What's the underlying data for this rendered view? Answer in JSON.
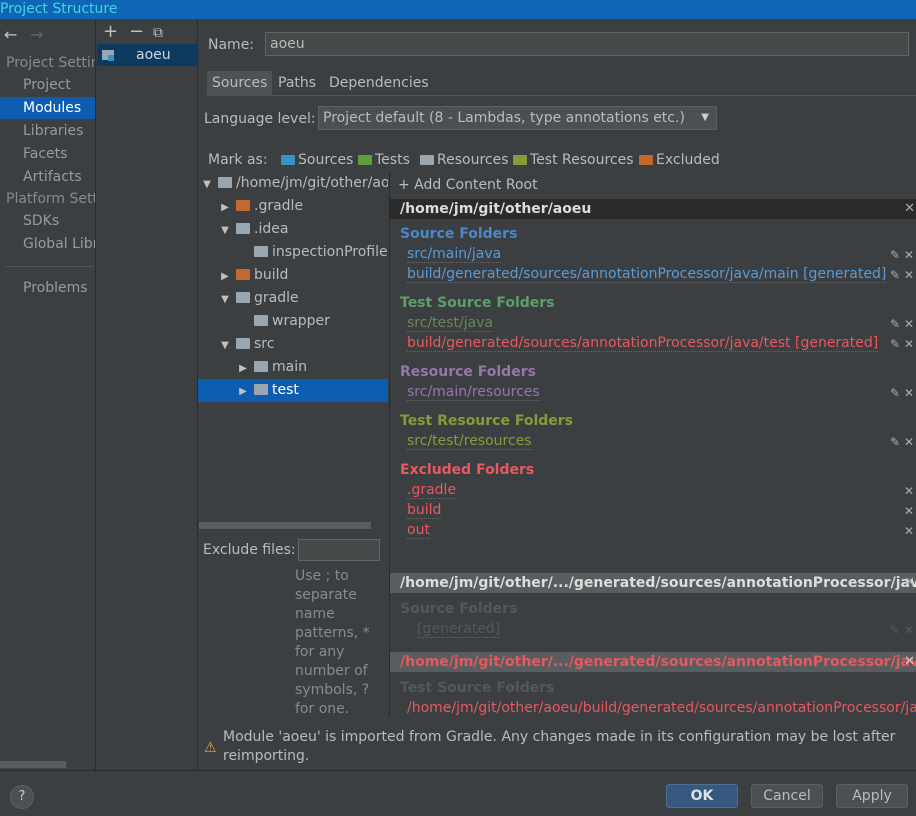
{
  "window": {
    "title": "Project Structure"
  },
  "nav": {
    "back": "←",
    "forward": "→",
    "project_settings": "Project Settings",
    "items_project": [
      "Project",
      "Modules",
      "Libraries",
      "Facets",
      "Artifacts"
    ],
    "platform_settings": "Platform Settings",
    "items_platform": [
      "SDKs",
      "Global Libraries"
    ],
    "problems": "Problems",
    "selected": "Modules"
  },
  "modules": {
    "add": "+",
    "remove": "−",
    "copy": "⧉",
    "items": [
      "aoeu"
    ]
  },
  "name": {
    "label": "Name:",
    "value": "aoeu"
  },
  "tabs": [
    "Sources",
    "Paths",
    "Dependencies"
  ],
  "selected_tab": "Sources",
  "language": {
    "label": "Language level:",
    "value": "Project default (8 - Lambdas, type annotations etc.)"
  },
  "mark_as": {
    "label": "Mark as:",
    "items": [
      "Sources",
      "Tests",
      "Resources",
      "Test Resources",
      "Excluded"
    ]
  },
  "tree": [
    {
      "label": "/home/jm/git/other/aoeu",
      "indent": 0,
      "arrow": "▼",
      "color": "grey"
    },
    {
      "label": ".gradle",
      "indent": 1,
      "arrow": "▶",
      "color": "orange"
    },
    {
      "label": ".idea",
      "indent": 1,
      "arrow": "▼",
      "color": "grey"
    },
    {
      "label": "inspectionProfiles",
      "indent": 2,
      "arrow": "",
      "color": "grey"
    },
    {
      "label": "build",
      "indent": 1,
      "arrow": "▶",
      "color": "orange"
    },
    {
      "label": "gradle",
      "indent": 1,
      "arrow": "▼",
      "color": "grey"
    },
    {
      "label": "wrapper",
      "indent": 2,
      "arrow": "",
      "color": "grey"
    },
    {
      "label": "src",
      "indent": 1,
      "arrow": "▼",
      "color": "grey"
    },
    {
      "label": "main",
      "indent": 2,
      "arrow": "▶",
      "color": "grey"
    },
    {
      "label": "test",
      "indent": 2,
      "arrow": "▶",
      "color": "grey",
      "selected": true
    }
  ],
  "exclude": {
    "label": "Exclude files:",
    "value": "",
    "hint": [
      "Use ; to",
      "separate",
      "name",
      "patterns, *",
      "for any",
      "number of",
      "symbols, ?",
      "for one."
    ]
  },
  "content_root": {
    "add": "+ Add Content Root",
    "root1": "/home/jm/git/other/aoeu",
    "source_folders": "Source Folders",
    "source_paths": [
      "src/main/java",
      "build/generated/sources/annotationProcessor/java/main [generated]"
    ],
    "test_source_folders": "Test Source Folders",
    "test_paths": [
      "src/test/java",
      "build/generated/sources/annotationProcessor/java/test [generated]"
    ],
    "resource_folders": "Resource Folders",
    "resource_paths": [
      "src/main/resources"
    ],
    "test_resource_folders": "Test Resource Folders",
    "test_resource_paths": [
      "src/test/resources"
    ],
    "excluded_folders": "Excluded Folders",
    "excluded_paths": [
      ".gradle",
      "build",
      "out"
    ],
    "root2": "/home/jm/git/other/.../generated/sources/annotationProcessor/java/main",
    "root2_section": "Source Folders",
    "root2_path": "[generated]",
    "root3": "/home/jm/git/other/.../generated/sources/annotationProcessor/java/test",
    "root3_section": "Test Source Folders",
    "root3_path": "/home/jm/git/other/aoeu/build/generated/sources/annotationProcessor/java/test"
  },
  "warning": {
    "icon": "⚠",
    "text": "Module 'aoeu' is imported from Gradle. Any changes made in its configuration may be lost after reimporting."
  },
  "buttons": {
    "help": "?",
    "ok": "OK",
    "cancel": "Cancel",
    "apply": "Apply"
  },
  "icons": {
    "edit": "✎",
    "close": "✕"
  },
  "colors": {
    "accent": "#0d5eb1",
    "sources": "#4a88c7",
    "tests": "#5e9e6a",
    "excluded": "#e8585f",
    "resources": "#9876aa",
    "test_resources": "#8a9a3a"
  }
}
